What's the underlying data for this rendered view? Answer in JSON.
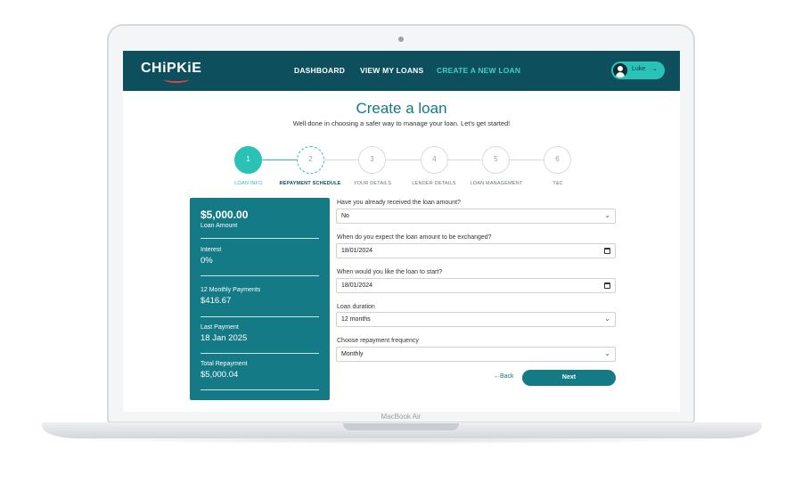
{
  "device": {
    "label": "MacBook Air"
  },
  "brand": {
    "logo_text": "CHiPKiE",
    "accent": "#2ac1b7",
    "primary": "#0d4f5c",
    "card": "#137a86",
    "logo_swoosh": "#e0453a"
  },
  "nav": {
    "links": [
      {
        "label": "DASHBOARD",
        "active": false
      },
      {
        "label": "VIEW MY LOANS",
        "active": false
      },
      {
        "label": "CREATE A NEW LOAN",
        "active": true
      }
    ],
    "user": {
      "name": "Luke",
      "icon": "user-avatar-icon",
      "chevron": "chevron-down-icon"
    }
  },
  "header": {
    "title": "Create a loan",
    "subtitle": "Well done in choosing a safer way to manage your loan. Let's get started!"
  },
  "stepper": {
    "steps": [
      {
        "number": "1",
        "label": "LOAN INFO",
        "state": "active"
      },
      {
        "number": "2",
        "label": "REPAYMENT SCHEDULE",
        "state": "next"
      },
      {
        "number": "3",
        "label": "YOUR DETAILS",
        "state": "pending"
      },
      {
        "number": "4",
        "label": "LENDER DETAILS",
        "state": "pending"
      },
      {
        "number": "5",
        "label": "LOAN MANAGEMENT",
        "state": "pending"
      },
      {
        "number": "6",
        "label": "T&C",
        "state": "pending"
      }
    ]
  },
  "summary": {
    "amount": "$5,000.00",
    "amount_label": "Loan Amount",
    "interest_label": "Interest",
    "interest_value": "0%",
    "monthly_label": "12 Monthly Payments",
    "monthly_value": "$416.67",
    "last_label": "Last Payment",
    "last_value": "18 Jan 2025",
    "total_label": "Total Repayment",
    "total_value": "$5,000.04"
  },
  "form": {
    "received": {
      "label": "Have you already received the loan amount?",
      "value": "No"
    },
    "exchange_date": {
      "label": "When do you expect the loan amount to be exchanged?",
      "value": "18/01/2024"
    },
    "start_date": {
      "label": "When would you like the loan to start?",
      "value": "18/01/2024"
    },
    "duration": {
      "label": "Loan duration",
      "value": "12 months"
    },
    "frequency": {
      "label": "Choose repayment frequency",
      "value": "Monthly"
    },
    "back_label": "←Back",
    "next_label": "Next"
  }
}
